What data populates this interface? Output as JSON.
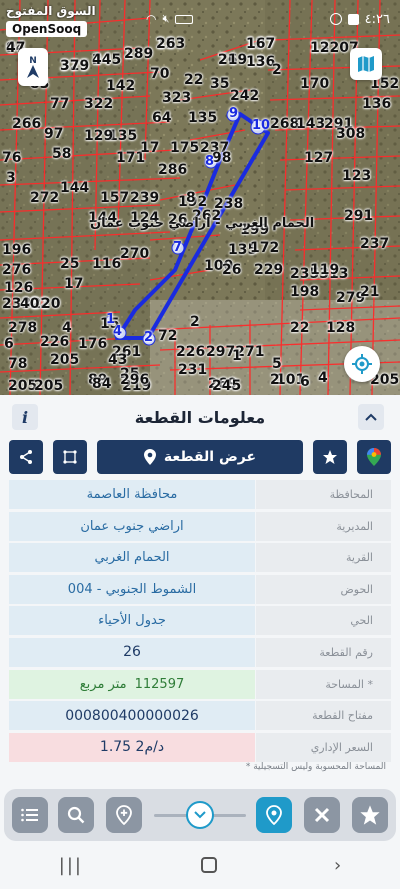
{
  "status": {
    "time": "٤:٢٦"
  },
  "brand": {
    "arabic": "السوق المفتوح",
    "english": "OpenSooq"
  },
  "map": {
    "parcel_numbers": [
      "94",
      "137",
      "13207",
      "123",
      "325",
      "245",
      "189",
      "76",
      "136",
      "2",
      "70",
      "22",
      "35",
      "170",
      "152",
      "83",
      "77",
      "322",
      "142",
      "323",
      "242",
      "136",
      "268",
      "135",
      "64",
      "135",
      "143",
      "291",
      "266",
      "97",
      "129",
      "171",
      "17",
      "175",
      "237",
      "127",
      "308",
      "76",
      "58",
      "286",
      "98",
      "123",
      "3",
      "144",
      "157",
      "239",
      "192",
      "262",
      "8",
      "238",
      "291",
      "272",
      "144",
      "124",
      "26",
      "199",
      "237",
      "196",
      "270",
      "135",
      "172",
      "100",
      "26",
      "229",
      "235313",
      "276",
      "25",
      "116",
      "119",
      "126",
      "17",
      "198",
      "22",
      "233220",
      "40",
      "279",
      "21",
      "278",
      "4",
      "15",
      "72",
      "2",
      "22",
      "128",
      "6",
      "226",
      "176",
      "261",
      "43",
      "226",
      "297271",
      "1",
      "5",
      "78",
      "205",
      "89",
      "25",
      "231",
      "269",
      "101",
      "4",
      "46",
      "205",
      "205",
      "84",
      "219",
      "296",
      "245",
      "2",
      "6",
      "205",
      "47",
      "167",
      "12",
      "26",
      "379",
      "44",
      "2",
      "219",
      "13"
    ],
    "district_label": "الحمام الغربي - اراضي جنوب عمان",
    "vertex_labels": [
      "1",
      "2",
      "4",
      "7",
      "8",
      "9",
      "10"
    ],
    "compass": "N"
  },
  "sheet": {
    "title": "معلومات القطعة",
    "info_label": "i",
    "show_parcel_label": "عرض القطعة",
    "rows": [
      {
        "label": "المحافظة",
        "value": "محافظة العاصمة"
      },
      {
        "label": "المديرية",
        "value": "اراضي جنوب عمان"
      },
      {
        "label": "القرية",
        "value": "الحمام الغربي"
      },
      {
        "label": "الحوض",
        "value": "الشموط الجنوبي - 004"
      },
      {
        "label": "الحي",
        "value": "جدول الأحياء"
      },
      {
        "label": "رقم القطعة",
        "value": "26"
      },
      {
        "label": "المساحة *",
        "value": "112597",
        "unit": "متر مربع"
      },
      {
        "label": "مفتاح القطعة",
        "value": "000800400000026"
      },
      {
        "label": "السعر الإداري",
        "value": "1.75 د/م2"
      }
    ],
    "footnote": "* المساحة المحسوبة وليس التسجيلية"
  },
  "colors": {
    "primary": "#1f3a63",
    "accent_teal": "#1f9ac9",
    "parcel_outline": "#1a2be0",
    "cadastre": "#ff2020"
  }
}
